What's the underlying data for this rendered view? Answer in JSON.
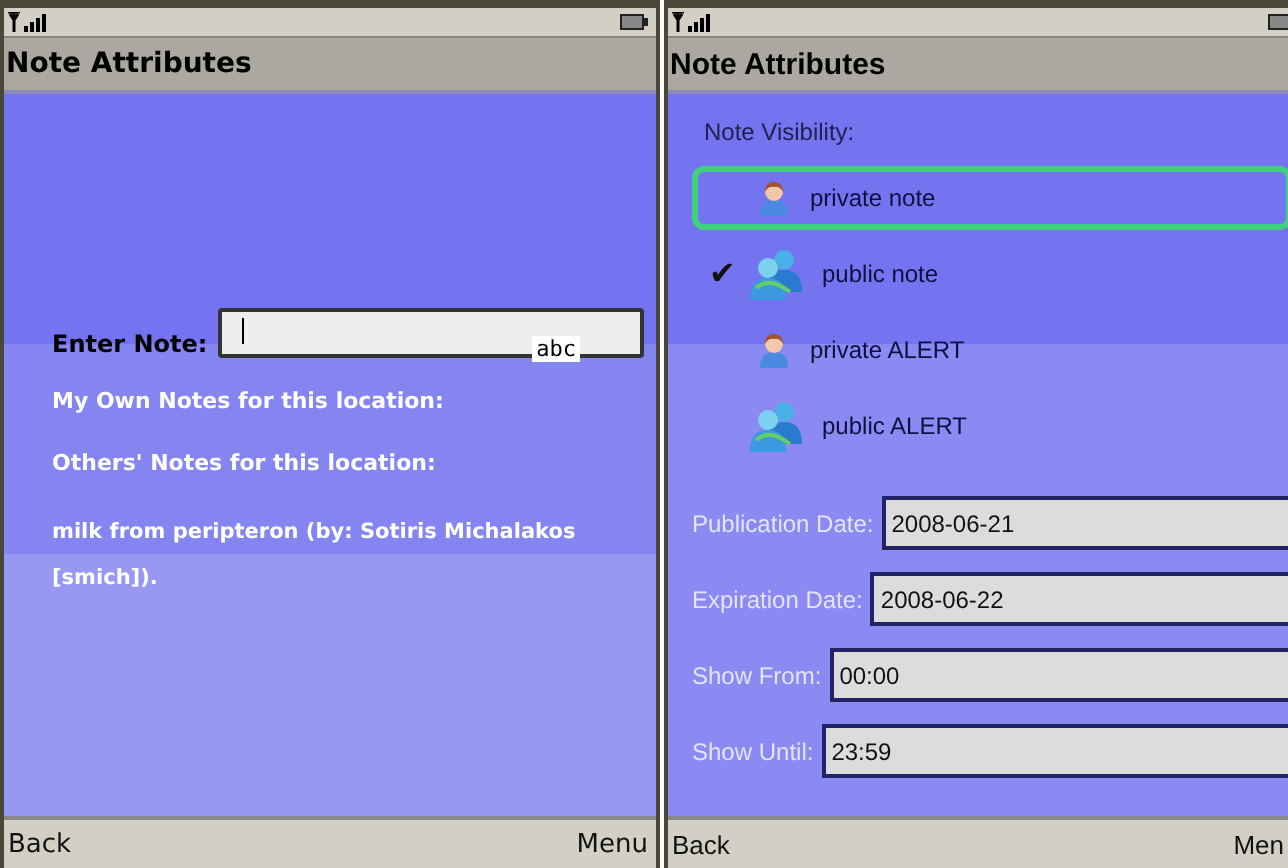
{
  "screens": [
    {
      "kind": "note_entry",
      "title": "Note Attributes",
      "field": {
        "label": "Enter Note:",
        "mode": "abc"
      },
      "sections": [
        "My Own Notes for this location:",
        "Others' Notes for this location:"
      ],
      "notes": [
        "milk from peripteron (by: Sotiris Michalakos [smich])."
      ],
      "soft_keys": {
        "left": "Back",
        "right": "Menu"
      }
    },
    {
      "kind": "attributes",
      "title": "Note Attributes",
      "group_label": "Note Visibility:",
      "options": [
        {
          "label": "private note",
          "kind": "person",
          "checked": false,
          "selected": true
        },
        {
          "label": "public note",
          "kind": "group",
          "checked": true,
          "selected": false
        },
        {
          "label": "private ALERT",
          "kind": "person",
          "checked": false,
          "selected": false
        },
        {
          "label": "public ALERT",
          "kind": "group",
          "checked": false,
          "selected": false
        }
      ],
      "check_mark": "✔",
      "fields": [
        {
          "label": "Publication Date:",
          "value": "2008-06-21"
        },
        {
          "label": "Expiration Date:",
          "value": "2008-06-22"
        },
        {
          "label": "Show From:",
          "value": "00:00"
        },
        {
          "label": "Show Until:",
          "value": "23:59"
        }
      ],
      "soft_keys": {
        "left": "Back",
        "right": "Men"
      }
    }
  ]
}
